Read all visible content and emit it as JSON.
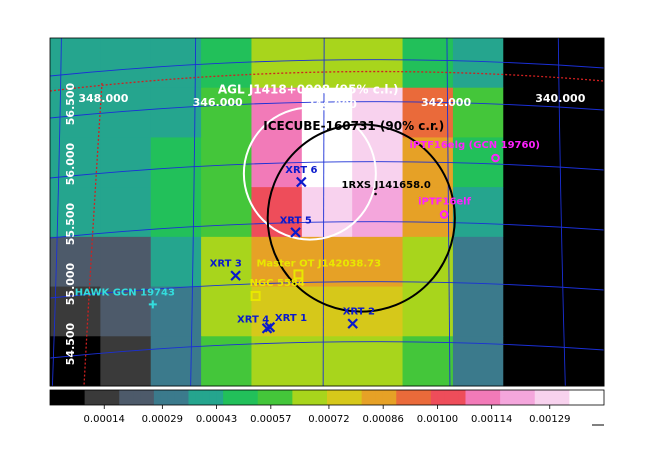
{
  "chart_data": {
    "type": "heatmap",
    "colormap": [
      "#000000",
      "#3a3a3a",
      "#4d5a6a",
      "#3b7a8c",
      "#25a58e",
      "#22c05a",
      "#44c63a",
      "#a8d51c",
      "#d6c81a",
      "#e6a126",
      "#ea6a3a",
      "#ee4d5a",
      "#f27ab8",
      "#f4a6dc",
      "#f8d2ee",
      "#ffffff"
    ],
    "colorbar": {
      "min": 0.0,
      "max": 0.00143,
      "tick_values": [
        0.00014,
        0.00029,
        0.00043,
        0.00057,
        0.00072,
        0.00086,
        0.001,
        0.00114,
        0.00129
      ],
      "tick_labels": [
        "0.00014",
        "0.00029",
        "0.00043",
        "0.00057",
        "0.00072",
        "0.00086",
        "0.00100",
        "0.00114",
        "0.00129"
      ]
    },
    "grid": {
      "cols": 11,
      "rows": 7,
      "values": [
        [
          0.00038,
          0.0004,
          0.00042,
          0.00045,
          0.00063,
          0.00063,
          0.00063,
          0.0005,
          0.0004,
          0.0,
          0.0
        ],
        [
          0.0004,
          0.00041,
          0.00044,
          0.0006,
          0.00116,
          0.00135,
          0.00126,
          0.0009,
          0.00058,
          0.0,
          0.0
        ],
        [
          0.00041,
          0.00043,
          0.0005,
          0.00062,
          0.0011,
          0.00143,
          0.00128,
          0.00088,
          0.00048,
          0.0,
          0.0
        ],
        [
          0.00042,
          0.00044,
          0.00046,
          0.0006,
          0.00105,
          0.00134,
          0.00118,
          0.00083,
          0.0004,
          0.0,
          0.0
        ],
        [
          0.0002,
          0.00022,
          0.00036,
          0.0007,
          0.00082,
          0.00082,
          0.00081,
          0.00068,
          0.00034,
          0.0,
          0.0
        ],
        [
          0.0001,
          0.00018,
          0.00034,
          0.00064,
          0.00073,
          0.00073,
          0.00072,
          0.00063,
          0.0003,
          0.0,
          0.0
        ],
        [
          0.0,
          0.0001,
          0.00032,
          0.0006,
          0.00066,
          0.00066,
          0.00065,
          0.00058,
          0.00028,
          0.0,
          0.0
        ]
      ]
    },
    "ra_labels": [
      {
        "text": "348.000",
        "ra": 348.0
      },
      {
        "text": "346.000",
        "ra": 346.0
      },
      {
        "text": "344.000",
        "ra": 344.0
      },
      {
        "text": "342.000",
        "ra": 342.0
      },
      {
        "text": "340.000",
        "ra": 340.0
      }
    ],
    "dec_labels": [
      {
        "text": "56.500",
        "dec": 56.5
      },
      {
        "text": "56.000",
        "dec": 56.0
      },
      {
        "text": "55.500",
        "dec": 55.5
      },
      {
        "text": "55.000",
        "dec": 55.0
      },
      {
        "text": "54.500",
        "dec": 54.5
      }
    ],
    "circles": [
      {
        "label": "AGL J1418+0008 (95% c.l.)",
        "color": "#ffffff",
        "ra": 344.35,
        "dec": 55.92,
        "radius_deg": 0.55
      },
      {
        "label": "ICECUBE-160731 (90% c.r.)",
        "color": "#000000",
        "ra": 343.45,
        "dec": 55.55,
        "radius_deg": 0.78
      }
    ],
    "markers": [
      {
        "label": "XRT 6",
        "symbol": "x",
        "color": "#0a1acc",
        "ra": 344.5,
        "dec": 55.85
      },
      {
        "label": "XRT 5",
        "symbol": "x",
        "color": "#0a1acc",
        "ra": 344.6,
        "dec": 55.43
      },
      {
        "label": "XRT 3",
        "symbol": "x",
        "color": "#0a1acc",
        "ra": 345.65,
        "dec": 55.07
      },
      {
        "label": "XRT 4",
        "symbol": "x",
        "color": "#0a1acc",
        "ra": 345.1,
        "dec": 54.63
      },
      {
        "label": "XRT 1",
        "symbol": "x",
        "color": "#0a1acc",
        "ra": 345.05,
        "dec": 54.64
      },
      {
        "label": "XRT 2",
        "symbol": "x",
        "color": "#0a1acc",
        "ra": 343.6,
        "dec": 54.67
      },
      {
        "label": "1RXS J141658.0",
        "symbol": "dot",
        "color": "#000000",
        "ra": 343.2,
        "dec": 55.75
      },
      {
        "label": "Master OT J142038.73",
        "symbol": "square",
        "color": "#e8e800",
        "ra": 344.55,
        "dec": 55.08
      },
      {
        "label": "NGC 5584",
        "symbol": "square",
        "color": "#e8e800",
        "ra": 345.3,
        "dec": 54.9
      },
      {
        "label": "HAWK GCN 19743",
        "symbol": "plus",
        "color": "#33dddd",
        "ra": 347.1,
        "dec": 54.83
      },
      {
        "label": "iPTF16elg (GCN 19760)",
        "symbol": "diamond",
        "color": "#ff22ff",
        "ra": 341.1,
        "dec": 56.05
      },
      {
        "label": "iPTF16elf",
        "symbol": "diamond",
        "color": "#ff22ff",
        "ra": 342.0,
        "dec": 55.58
      }
    ]
  }
}
